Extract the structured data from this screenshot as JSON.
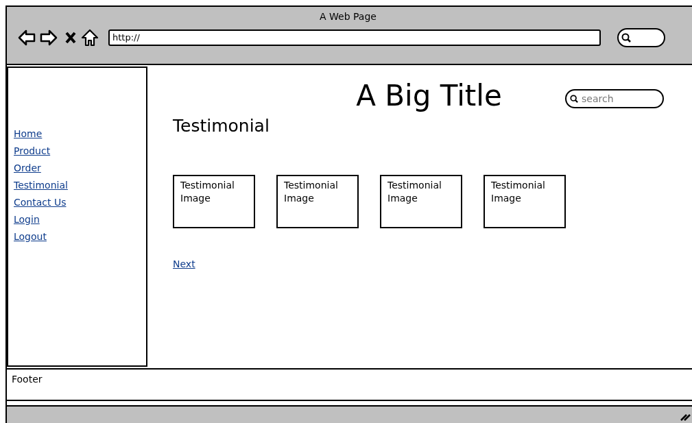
{
  "window": {
    "title": "A Web Page"
  },
  "address_bar": {
    "value": "http://"
  },
  "sidebar": {
    "items": [
      "Home",
      "Product",
      "Order",
      "Testimonial",
      "Contact Us",
      "Login",
      "Logout"
    ]
  },
  "main": {
    "title": "A Big Title",
    "search": {
      "placeholder": "search"
    },
    "heading": "Testimonial",
    "cards": [
      {
        "label": "Testimonial Image"
      },
      {
        "label": "Testimonial Image"
      },
      {
        "label": "Testimonial Image"
      },
      {
        "label": "Testimonial Image"
      }
    ],
    "next_link": "Next"
  },
  "footer": {
    "text": "Footer"
  }
}
